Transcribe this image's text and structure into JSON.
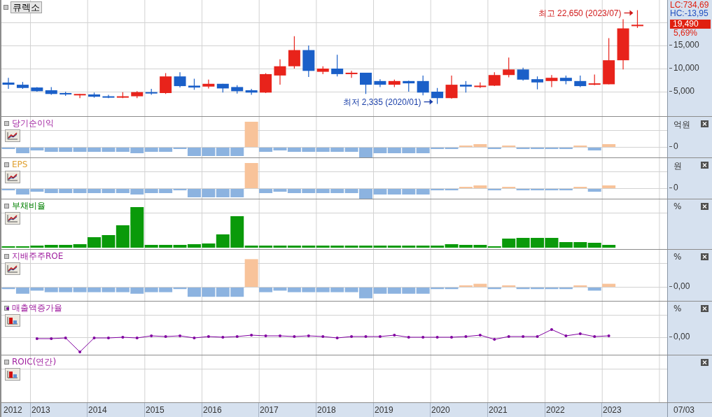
{
  "stock_label": "큐렉소",
  "price_panel": {
    "axis": {
      "lc": "LC:734,69",
      "hc": "HC:-13,95",
      "last_price": "19,490",
      "change": "5,69%",
      "ticks": [
        "15,000",
        "10,000",
        "5,000"
      ]
    },
    "annotations": [
      {
        "kind": "high",
        "text": "최고 22,650 (2023/07)"
      },
      {
        "kind": "low",
        "text": "최저 2,335 (2020/01)"
      }
    ]
  },
  "indicator_panels": [
    {
      "title": "당기순이익",
      "kind": "signed-bars",
      "chart_button": {
        "kind": "line"
      },
      "marker": false,
      "unit": "억원",
      "zero_label": "0"
    },
    {
      "title": "EPS",
      "kind": "signed-bars",
      "chart_button": {
        "kind": "line"
      },
      "marker": false,
      "unit": "원",
      "zero_label": "0"
    },
    {
      "title": "부채비율",
      "kind": "columns",
      "chart_button": {
        "kind": "line"
      },
      "marker": false,
      "unit": "%"
    },
    {
      "title": "지배주주ROE",
      "kind": "signed-bars",
      "chart_button": {
        "kind": "line"
      },
      "marker": false,
      "unit": "%",
      "zero_label": "0,00"
    },
    {
      "title": "매출액증가율",
      "kind": "line",
      "chart_button": {
        "kind": "bars"
      },
      "marker": true,
      "unit": "%",
      "zero_label": "0,00"
    },
    {
      "title": "ROIC(연간)",
      "kind": "empty",
      "chart_button": {
        "kind": "bars"
      },
      "marker": false
    }
  ],
  "x_axis": {
    "labels": [
      "2012",
      "2013",
      "2014",
      "2015",
      "2016",
      "2017",
      "2018",
      "2019",
      "2020",
      "2021",
      "2022",
      "2023"
    ],
    "cursor_date": "07/03"
  }
}
